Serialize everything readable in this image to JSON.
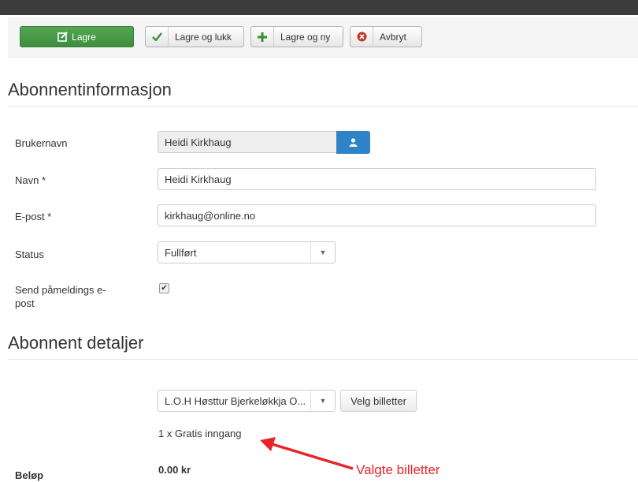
{
  "toolbar": {
    "save": "Lagre",
    "save_close": "Lagre og lukk",
    "save_new": "Lagre og ny",
    "cancel": "Avbryt"
  },
  "sections": {
    "info": "Abonnentinformasjon",
    "details": "Abonnent detaljer"
  },
  "form": {
    "username_label": "Brukernavn",
    "username_value": "Heidi Kirkhaug",
    "name_label": "Navn *",
    "name_value": "Heidi Kirkhaug",
    "email_label": "E-post *",
    "email_value": "kirkhaug@online.no",
    "status_label": "Status",
    "status_value": "Fullført",
    "send_email_label_line1": "Send påmeldings e-",
    "send_email_label_line2": "post",
    "send_email_checked": true
  },
  "details": {
    "event_value": "L.O.H Høsttur Bjerkeløkkja O...",
    "choose_tickets": "Velg billetter",
    "ticket_summary": "1 x Gratis inngang",
    "amount_label": "Beløp",
    "amount_value": "0.00 kr"
  },
  "annotation": {
    "text": "Valgte billetter",
    "color": "#e8242a"
  },
  "colors": {
    "save_green": "#46a046",
    "user_blue": "#2f84c8",
    "cancel_red": "#c0392b"
  }
}
